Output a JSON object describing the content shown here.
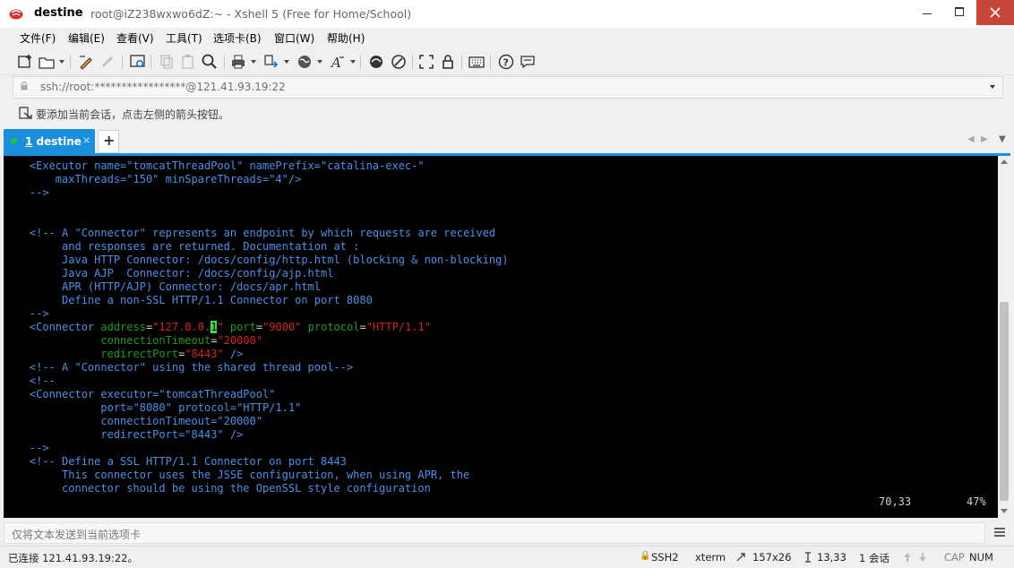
{
  "window": {
    "session_name": "destine",
    "title": "root@iZ238wxwo6dZ:~ - Xshell 5 (Free for Home/School)"
  },
  "menu": [
    "文件(F)",
    "编辑(E)",
    "查看(V)",
    "工具(T)",
    "选项卡(B)",
    "窗口(W)",
    "帮助(H)"
  ],
  "address": {
    "value": "ssh://root:*****************@121.41.93.19:22"
  },
  "hint": {
    "text": "要添加当前会话，点击左侧的箭头按钮。"
  },
  "tabs": {
    "active_number": "1",
    "active_name": " destine",
    "close_glyph": "×",
    "add_glyph": "+"
  },
  "terminal": {
    "lines": [
      "    <Executor name=\"tomcatThreadPool\" namePrefix=\"catalina-exec-\"",
      "        maxThreads=\"150\" minSpareThreads=\"4\"/>",
      "    -->",
      "",
      "",
      "    <!-- A \"Connector\" represents an endpoint by which requests are received",
      "         and responses are returned. Documentation at :",
      "         Java HTTP Connector: /docs/config/http.html (blocking & non-blocking)",
      "         Java AJP  Connector: /docs/config/ajp.html",
      "         APR (HTTP/AJP) Connector: /docs/apr.html",
      "         Define a non-SSL HTTP/1.1 Connector on port 8080",
      "    -->"
    ],
    "connector": {
      "open": "    <Connector ",
      "address_attr": "address",
      "eq": "=",
      "address_before_cursor": "\"127.0.0.",
      "cursor_char": "1",
      "address_after_cursor": "\"",
      "port_attr": "port",
      "port_value": "\"9000\"",
      "protocol_attr": "protocol",
      "protocol_value": "\"HTTP/1.1\"",
      "indent": "               ",
      "timeout_attr": "connectionTimeout",
      "timeout_value": "\"20000\"",
      "redirect_attr": "redirectPort",
      "redirect_value": "\"8443\"",
      "close": " />"
    },
    "lines_after": [
      "    <!-- A \"Connector\" using the shared thread pool-->",
      "    <!--",
      "    <Connector executor=\"tomcatThreadPool\"",
      "               port=\"8080\" protocol=\"HTTP/1.1\"",
      "               connectionTimeout=\"20000\"",
      "               redirectPort=\"8443\" />",
      "    -->",
      "    <!-- Define a SSL HTTP/1.1 Connector on port 8443",
      "         This connector uses the JSSE configuration, when using APR, the",
      "         connector should be using the OpenSSL style configuration"
    ],
    "cursor_pos": "70,33",
    "scroll_percent": "47%"
  },
  "send_bar": {
    "placeholder": "仅将文本发送到当前选项卡"
  },
  "statusbar": {
    "connection": "已连接 121.41.93.19:22。",
    "protocol": "SSH2",
    "term": "xterm",
    "size": "157x26",
    "position": "13,33",
    "sessions": "1 会话",
    "caps": "CAP",
    "num": "NUM"
  },
  "colors": {
    "accent": "#1a8fdc",
    "terminal_bg": "#000000",
    "terminal_text": "#4a90e8",
    "attr_green": "#1c9c1c",
    "value_red": "#d2261c",
    "cursor": "#3ce03c"
  }
}
